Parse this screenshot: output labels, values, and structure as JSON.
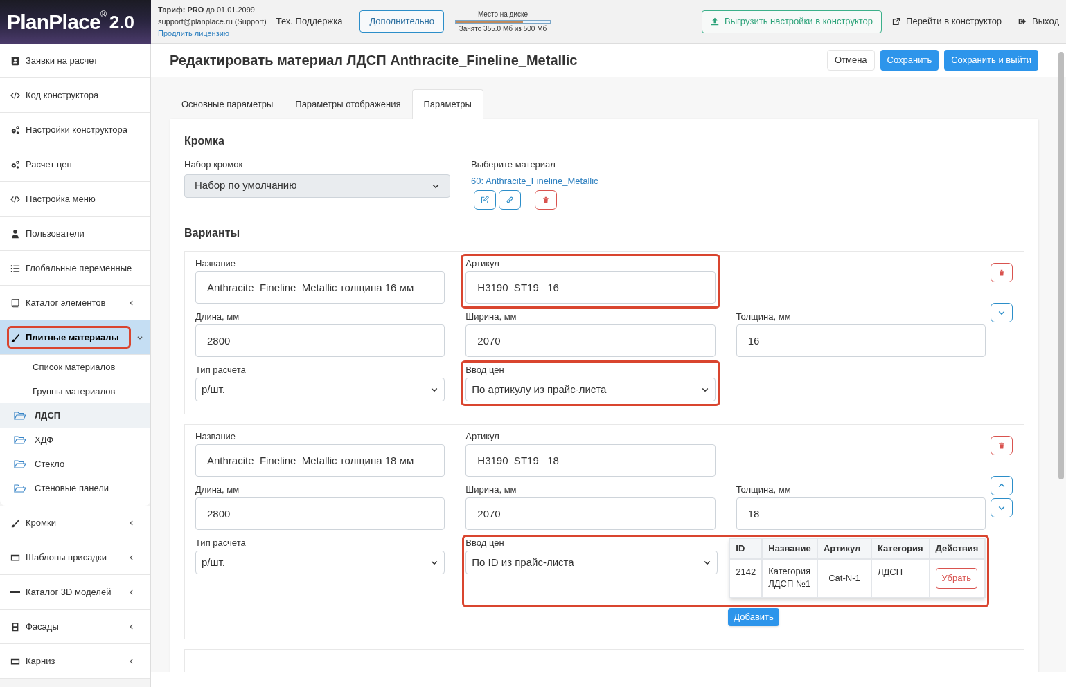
{
  "header": {
    "logo": "PlanPlace",
    "logo_mark": "®",
    "logo_version": "2.0",
    "tariff_label": "Тариф:",
    "tariff_plan": "PRO",
    "tariff_until": "до 01.01.2099",
    "account": "support@planplace.ru (Support)",
    "renew_link": "Продлить лицензию",
    "support": "Тех. Поддержка",
    "more_button": "Дополнительно",
    "disk": {
      "title": "Место на диске",
      "level": 0.71,
      "reading": "Занято 355.0 Мб из 500 Мб"
    },
    "export_button": "Выгрузить настройки в конструктор",
    "open_link": "Перейти в конструктор",
    "logout": "Выход"
  },
  "sidebar": {
    "items": [
      {
        "label": "Заявки на расчет",
        "selected": false
      },
      {
        "label": "Код конструктора",
        "selected": false
      },
      {
        "label": "Настройки конструктора",
        "selected": false
      },
      {
        "label": "Расчет цен",
        "selected": false
      },
      {
        "label": "Настройка меню",
        "selected": false
      },
      {
        "label": "Пользователи",
        "selected": false
      },
      {
        "label": "Глобальные переменные",
        "selected": false
      },
      {
        "label": "Каталог элементов",
        "selected": false,
        "expanded": false
      },
      {
        "label": "Плитные материалы",
        "selected": true,
        "expanded": true,
        "highlighted": true,
        "children": [
          {
            "label": "Список материалов",
            "kind": "link",
            "selected": false
          },
          {
            "label": "Группы материалов",
            "kind": "link",
            "selected": false
          },
          {
            "label": "ЛДСП",
            "kind": "folder",
            "selected": true
          },
          {
            "label": "ХДФ",
            "kind": "folder",
            "selected": false
          },
          {
            "label": "Стекло",
            "kind": "folder",
            "selected": false
          },
          {
            "label": "Стеновые панели",
            "kind": "folder",
            "selected": false
          }
        ]
      },
      {
        "label": "Кромки",
        "selected": false,
        "expanded": false
      },
      {
        "label": "Шаблоны присадки",
        "selected": false,
        "expanded": false
      },
      {
        "label": "Каталог 3D моделей",
        "selected": false,
        "expanded": false
      },
      {
        "label": "Фасады",
        "selected": false,
        "expanded": false
      },
      {
        "label": "Карниз",
        "selected": false,
        "expanded": false
      }
    ]
  },
  "page": {
    "title": "Редактировать материал ЛДСП Anthracite_Fineline_Metallic",
    "buttons": [
      {
        "label": "Отмена",
        "kind": "secondary"
      },
      {
        "label": "Сохранить",
        "kind": "primary"
      },
      {
        "label": "Сохранить и выйти",
        "kind": "primary"
      }
    ]
  },
  "tabs": [
    {
      "label": "Основные параметры",
      "selected": false
    },
    {
      "label": "Параметры отображения",
      "selected": false
    },
    {
      "label": "Параметры",
      "selected": true
    }
  ],
  "edge": {
    "title": "Кромка",
    "set_label": "Набор кромок",
    "set_value": "Набор по умолчанию",
    "material_label": "Выберите материал",
    "material_link": "60: Anthracite_Fineline_Metallic",
    "actions": [
      {
        "kind": "edit"
      },
      {
        "kind": "link"
      },
      {
        "kind": "delete"
      }
    ]
  },
  "variants_title": "Варианты",
  "variants": [
    {
      "actions": [
        {
          "kind": "delete"
        },
        {
          "kind": "down"
        }
      ],
      "fields": [
        {
          "label": "Название",
          "value": "Anthracite_Fineline_Metallic толщина 16 мм",
          "kind": "input"
        },
        {
          "label": "Артикул",
          "value": "H3190_ST19_ 16",
          "kind": "input",
          "highlighted": true
        },
        {
          "kind": "empty"
        },
        {
          "label": "Длина, мм",
          "value": "2800",
          "kind": "input"
        },
        {
          "label": "Ширина, мм",
          "value": "2070",
          "kind": "input"
        },
        {
          "label": "Толщина, мм",
          "value": "16",
          "kind": "input"
        },
        {
          "label": "Тип расчета",
          "value": "р/шт.",
          "kind": "select"
        },
        {
          "label": "Ввод цен",
          "value": "По артикулу из прайс-листа",
          "kind": "select",
          "highlighted": true
        }
      ]
    },
    {
      "actions": [
        {
          "kind": "delete"
        },
        {
          "kind": "up"
        },
        {
          "kind": "down"
        }
      ],
      "fields": [
        {
          "label": "Название",
          "value": "Anthracite_Fineline_Metallic толщина 18 мм",
          "kind": "input"
        },
        {
          "label": "Артикул",
          "value": "H3190_ST19_ 18",
          "kind": "input"
        },
        {
          "kind": "empty"
        },
        {
          "label": "Длина, мм",
          "value": "2800",
          "kind": "input"
        },
        {
          "label": "Ширина, мм",
          "value": "2070",
          "kind": "input"
        },
        {
          "label": "Толщина, мм",
          "value": "18",
          "kind": "input"
        },
        {
          "label": "Тип расчета",
          "value": "р/шт.",
          "kind": "select"
        },
        {
          "label": "Ввод цен",
          "value": "По ID из прайс-листа",
          "kind": "price_table",
          "highlighted": true,
          "table": {
            "columns": [
              "ID",
              "Название",
              "Артикул",
              "Категория",
              "Действия"
            ],
            "rows": [
              {
                "id": "2142",
                "name": "Категория ЛДСП №1",
                "article": "Cat-N-1",
                "category": "ЛДСП",
                "action": "Убрать"
              }
            ]
          },
          "add_button": "Добавить"
        }
      ]
    }
  ]
}
